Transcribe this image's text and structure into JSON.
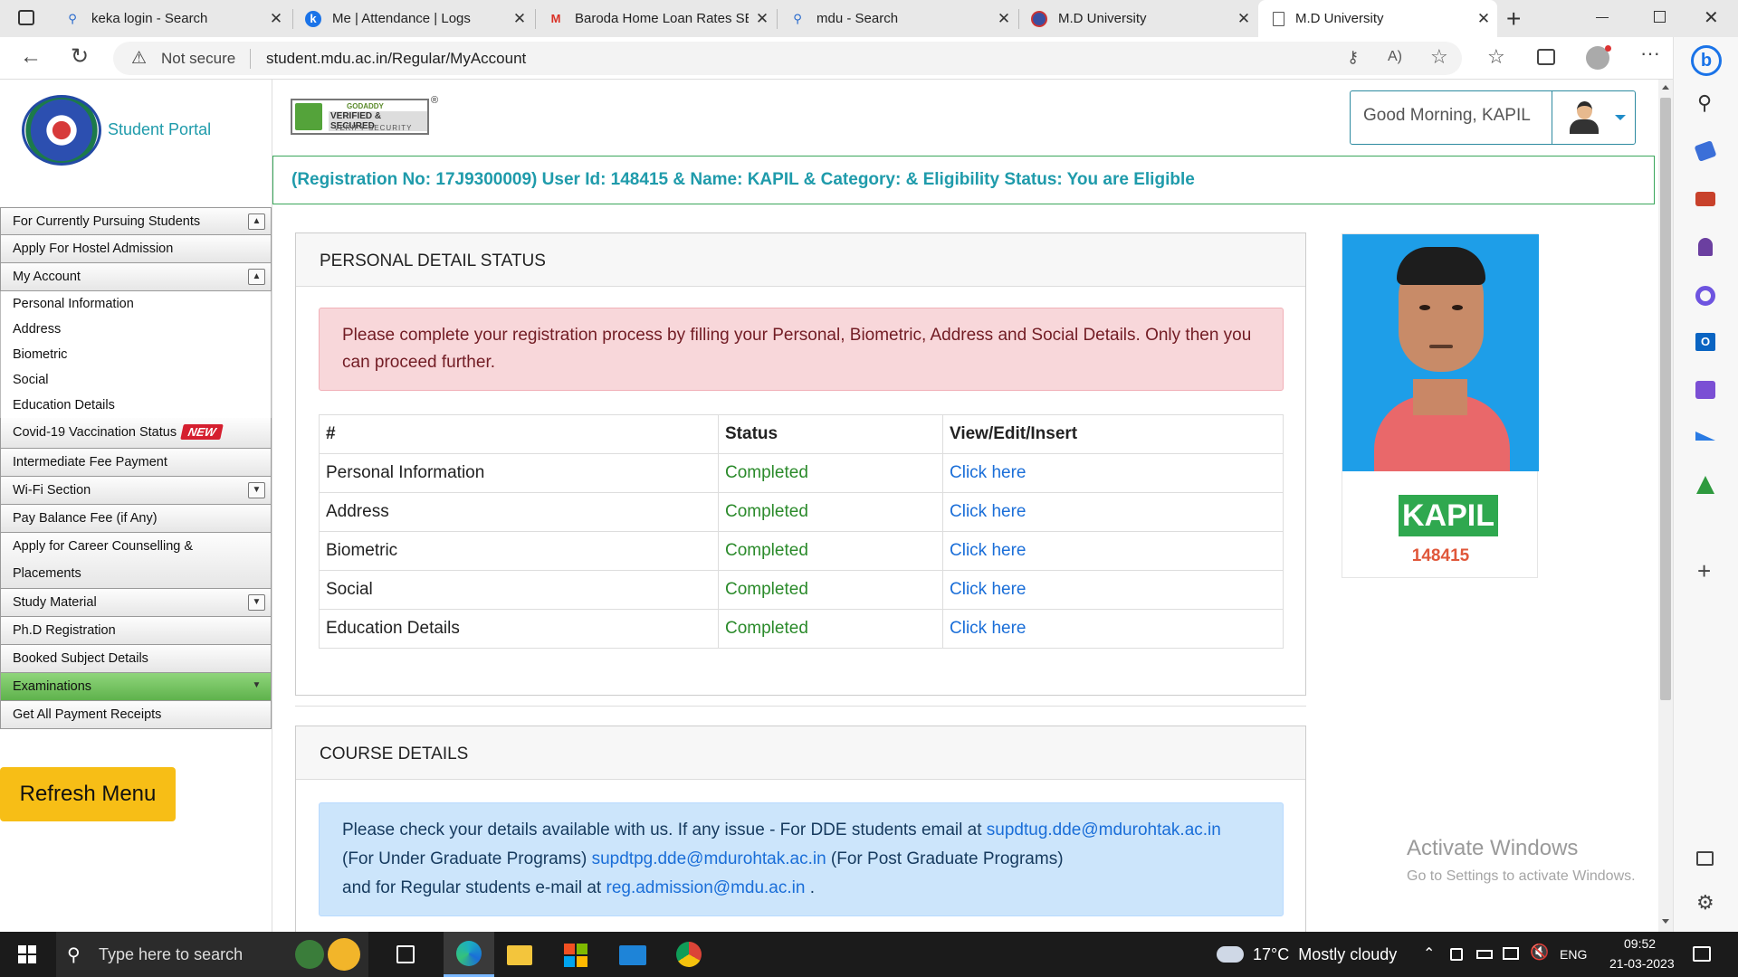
{
  "browser": {
    "tabs": [
      {
        "title": "keka login - Search",
        "icon": "search-icon"
      },
      {
        "title": "Me | Attendance | Logs",
        "icon": "keka-icon"
      },
      {
        "title": "Baroda Home Loan Rates SBI",
        "icon": "gmail-icon"
      },
      {
        "title": "mdu - Search",
        "icon": "search-icon"
      },
      {
        "title": "M.D University",
        "icon": "mdu-icon"
      },
      {
        "title": "M.D University",
        "icon": "page-icon"
      }
    ],
    "security": "Not secure",
    "url": "student.mdu.ac.in/Regular/MyAccount"
  },
  "header": {
    "portal_title": "Student Portal",
    "badge_line1": "GODADDY",
    "badge_line2": "VERIFIED & SECURED",
    "badge_line3": "VERIFY SECURITY",
    "greeting": "Good Morning, KAPIL"
  },
  "info_bar": "(Registration No: 17J9300009) User Id: 148415 & Name: KAPIL & Category: & Eligibility Status: You are Eligible",
  "menu": {
    "items": [
      {
        "label": "For Currently Pursuing Students",
        "toggle": "up"
      },
      {
        "label": "Apply For Hostel Admission"
      },
      {
        "label": "My Account",
        "toggle": "up"
      },
      {
        "label": "Personal Information",
        "sub": true
      },
      {
        "label": "Address",
        "sub": true
      },
      {
        "label": "Biometric",
        "sub": true
      },
      {
        "label": "Social",
        "sub": true
      },
      {
        "label": "Education Details",
        "sub": true
      },
      {
        "label": "Covid-19 Vaccination Status",
        "badge": "NEW"
      },
      {
        "label": "Intermediate Fee Payment"
      },
      {
        "label": "Wi-Fi Section",
        "toggle": "down"
      },
      {
        "label": "Pay Balance Fee (if Any)"
      },
      {
        "label": "Apply for Career Counselling & Placements"
      },
      {
        "label": "Study Material",
        "toggle": "down"
      },
      {
        "label": "Ph.D Registration"
      },
      {
        "label": "Booked Subject Details"
      },
      {
        "label": "Examinations",
        "toggle": "down",
        "highlight": true
      },
      {
        "label": "Get All Payment Receipts"
      }
    ],
    "refresh_button": "Refresh Menu"
  },
  "personal_status": {
    "heading": "PERSONAL DETAIL STATUS",
    "alert": "Please complete your registration process by filling your Personal, Biometric, Address and Social Details. Only then you can proceed further.",
    "columns": [
      "#",
      "Status",
      "View/Edit/Insert"
    ],
    "rows": [
      {
        "name": "Personal Information",
        "status": "Completed",
        "action": "Click here"
      },
      {
        "name": "Address",
        "status": "Completed",
        "action": "Click here"
      },
      {
        "name": "Biometric",
        "status": "Completed",
        "action": "Click here"
      },
      {
        "name": "Social",
        "status": "Completed",
        "action": "Click here"
      },
      {
        "name": "Education Details",
        "status": "Completed",
        "action": "Click here"
      }
    ]
  },
  "course_details": {
    "heading": "COURSE DETAILS",
    "text1": "Please check your details available with us. If any issue - For DDE students email at ",
    "email1": "supdtug.dde@mdurohtak.ac.in",
    "text2": "(For Under Graduate Programs) ",
    "email2": "supdtpg.dde@mdurohtak.ac.in",
    "text3": " (For Post Graduate Programs)",
    "text4": "and for Regular students e-mail at ",
    "email3": "reg.admission@mdu.ac.in",
    "text5": " ."
  },
  "profile": {
    "name": "KAPIL",
    "user_id": "148415"
  },
  "watermark": {
    "line1": "Activate Windows",
    "line2": "Go to Settings to activate Windows."
  },
  "taskbar": {
    "search_placeholder": "Type here to search",
    "weather": "17°C  Mostly cloudy",
    "lang": "ENG",
    "time": "09:52",
    "date": "21-03-2023"
  },
  "colors": {
    "accent_teal": "#1f9bab",
    "info_border": "#3aa65a",
    "alert_bg": "#f8d7da",
    "info_bg": "#cce5fb",
    "refresh_btn": "#f7be16",
    "name_badge": "#2fa84f",
    "id_text": "#e0573a",
    "photo_bg": "#1e9ee8"
  }
}
